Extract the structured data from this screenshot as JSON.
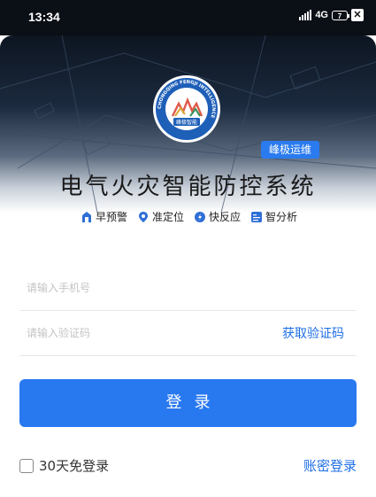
{
  "status_bar": {
    "time": "13:34",
    "network": "4G",
    "battery": "7",
    "close_glyph": "✕"
  },
  "logo": {
    "ring_text": "CHONGQING FENGJI INTELLIGENCE",
    "inner_text": "峰极智能",
    "colors": {
      "ring": "#1e5fb8",
      "inner": "#ffffff",
      "peaks": [
        "#e05a4a",
        "#d9a936",
        "#2f8f55"
      ]
    }
  },
  "badge": {
    "label": "峰极运维"
  },
  "app_title": "电气火灾智能防控系统",
  "features": [
    {
      "icon": "building-icon",
      "label": "早预警"
    },
    {
      "icon": "location-pin-icon",
      "label": "准定位"
    },
    {
      "icon": "lightning-icon",
      "label": "快反应"
    },
    {
      "icon": "report-icon",
      "label": "智分析"
    }
  ],
  "form": {
    "phone_placeholder": "请输入手机号",
    "phone_value": "",
    "code_placeholder": "请输入验证码",
    "code_value": "",
    "get_code_label": "获取验证码"
  },
  "login_button": "登录",
  "remember_label": "30天免登录",
  "password_login_label": "账密登录",
  "colors": {
    "accent": "#2878f0",
    "link": "#1f6fe5",
    "status_bar": "#0b0f16"
  }
}
